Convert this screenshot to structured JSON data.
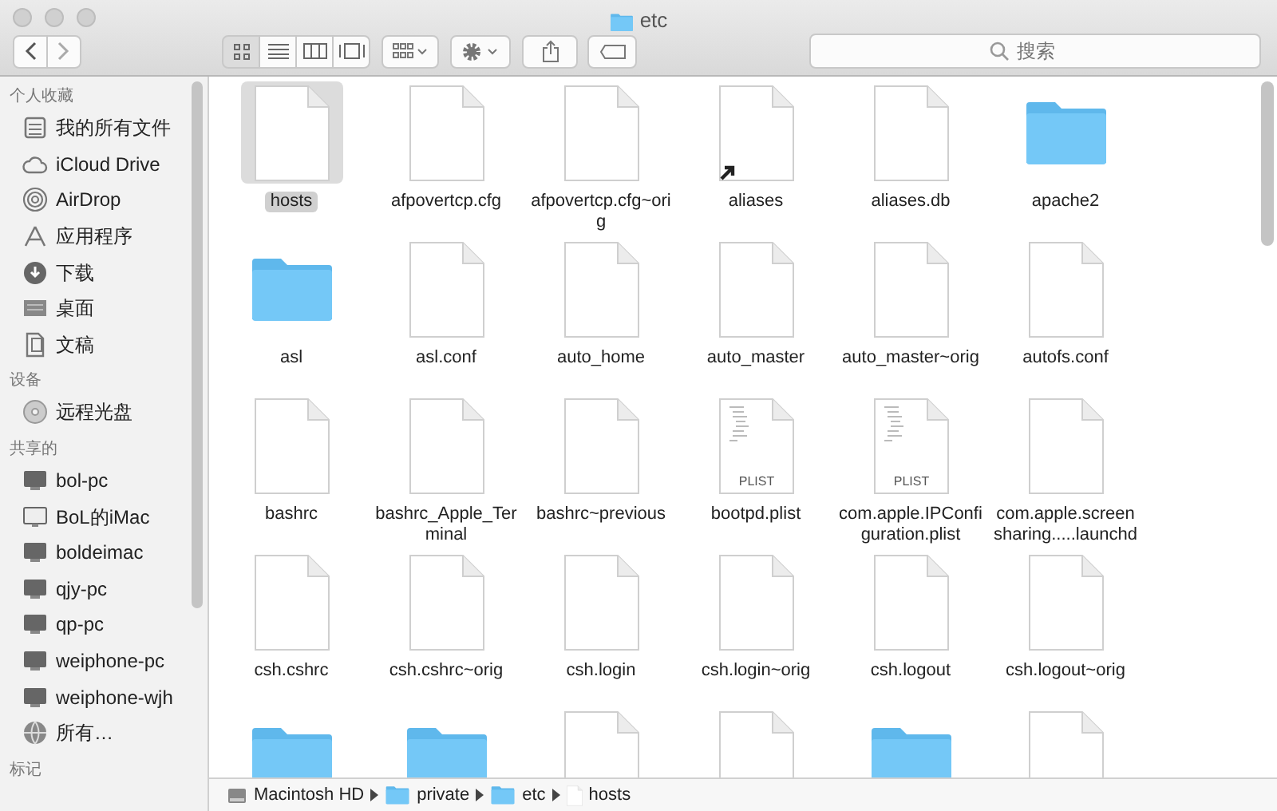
{
  "window": {
    "title": "etc"
  },
  "search": {
    "placeholder": "搜索"
  },
  "sidebar": {
    "sections": [
      {
        "heading": "个人收藏",
        "items": [
          {
            "label": "我的所有文件",
            "kind": "files"
          },
          {
            "label": "iCloud Drive",
            "kind": "cloud"
          },
          {
            "label": "AirDrop",
            "kind": "airdrop"
          },
          {
            "label": "应用程序",
            "kind": "apps"
          },
          {
            "label": "下载",
            "kind": "download"
          },
          {
            "label": "桌面",
            "kind": "desktop"
          },
          {
            "label": "文稿",
            "kind": "docs"
          }
        ]
      },
      {
        "heading": "设备",
        "items": [
          {
            "label": "远程光盘",
            "kind": "disc"
          }
        ]
      },
      {
        "heading": "共享的",
        "items": [
          {
            "label": "bol-pc",
            "kind": "pc"
          },
          {
            "label": "BoL的iMac",
            "kind": "imac"
          },
          {
            "label": "boldeimac",
            "kind": "pc"
          },
          {
            "label": "qjy-pc",
            "kind": "pc"
          },
          {
            "label": "qp-pc",
            "kind": "pc"
          },
          {
            "label": "weiphone-pc",
            "kind": "pc"
          },
          {
            "label": "weiphone-wjh",
            "kind": "pc"
          },
          {
            "label": "所有…",
            "kind": "globe"
          }
        ]
      },
      {
        "heading": "标记"
      }
    ]
  },
  "files": [
    {
      "name": "hosts",
      "kind": "doc",
      "selected": true
    },
    {
      "name": "afpovertcp.cfg",
      "kind": "doc",
      "selected": false
    },
    {
      "name": "afpovertcp.cfg~orig",
      "kind": "doc",
      "selected": false
    },
    {
      "name": "aliases",
      "kind": "alias",
      "selected": false
    },
    {
      "name": "aliases.db",
      "kind": "doc",
      "selected": false
    },
    {
      "name": "apache2",
      "kind": "folder",
      "selected": false
    },
    {
      "name": "asl",
      "kind": "folder",
      "selected": false
    },
    {
      "name": "asl.conf",
      "kind": "doc",
      "selected": false
    },
    {
      "name": "auto_home",
      "kind": "doc",
      "selected": false
    },
    {
      "name": "auto_master",
      "kind": "doc",
      "selected": false
    },
    {
      "name": "auto_master~orig",
      "kind": "doc",
      "selected": false
    },
    {
      "name": "autofs.conf",
      "kind": "doc",
      "selected": false
    },
    {
      "name": "bashrc",
      "kind": "doc",
      "selected": false
    },
    {
      "name": "bashrc_Apple_Terminal",
      "kind": "doc",
      "selected": false
    },
    {
      "name": "bashrc~previous",
      "kind": "doc",
      "selected": false
    },
    {
      "name": "bootpd.plist",
      "kind": "plist",
      "badge": "PLIST",
      "selected": false
    },
    {
      "name": "com.apple.IPConfiguration.plist",
      "kind": "plist",
      "badge": "PLIST",
      "selected": false
    },
    {
      "name": "com.apple.screensharing.....launchd",
      "kind": "doc",
      "selected": false
    },
    {
      "name": "csh.cshrc",
      "kind": "doc",
      "selected": false
    },
    {
      "name": "csh.cshrc~orig",
      "kind": "doc",
      "selected": false
    },
    {
      "name": "csh.login",
      "kind": "doc",
      "selected": false
    },
    {
      "name": "csh.login~orig",
      "kind": "doc",
      "selected": false
    },
    {
      "name": "csh.logout",
      "kind": "doc",
      "selected": false
    },
    {
      "name": "csh.logout~orig",
      "kind": "doc",
      "selected": false
    },
    {
      "kind": "folder",
      "selected": false
    },
    {
      "kind": "folder",
      "selected": false
    },
    {
      "kind": "doc",
      "selected": false
    },
    {
      "kind": "doc",
      "selected": false
    },
    {
      "kind": "folder",
      "selected": false
    },
    {
      "kind": "doc",
      "selected": false
    }
  ],
  "path_bar": [
    {
      "label": "Macintosh HD",
      "kind": "disk"
    },
    {
      "label": "private",
      "kind": "folder"
    },
    {
      "label": "etc",
      "kind": "folder"
    },
    {
      "label": "hosts",
      "kind": "doc"
    }
  ]
}
